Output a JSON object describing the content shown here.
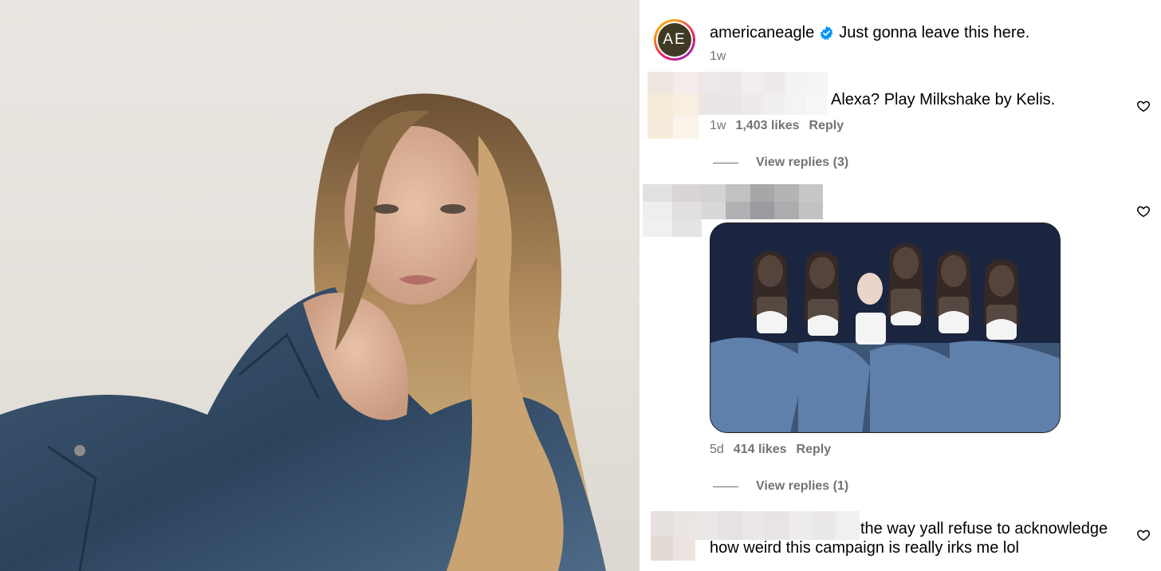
{
  "post": {
    "avatar_text": "AE",
    "handle": "americaneagle",
    "caption": "Just gonna leave this here.",
    "age": "1w"
  },
  "comments": [
    {
      "text": "Alexa? Play Milkshake by Kelis.",
      "age": "1w",
      "likes": "1,403 likes",
      "reply": "Reply",
      "view_replies": "View replies (3)"
    },
    {
      "text": "",
      "age": "5d",
      "likes": "414 likes",
      "reply": "Reply",
      "view_replies": "View replies (1)"
    },
    {
      "text_line1": "the way yall refuse to acknowledge",
      "text_line2": "how weird this campaign is really irks me lol"
    }
  ],
  "colors": {
    "verified": "#0095f6",
    "muted": "#737373",
    "avatar_bg": "#3e3a24"
  },
  "icons": [
    "verified-badge-icon",
    "heart-icon"
  ]
}
